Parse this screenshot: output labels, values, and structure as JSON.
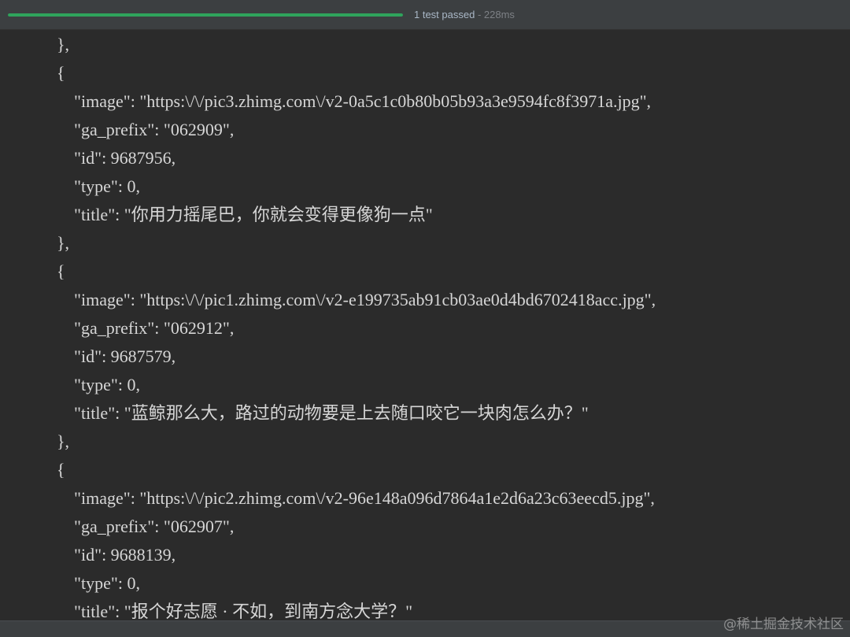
{
  "status": {
    "summary": "1 test passed",
    "duration": " - 228ms",
    "progress_percent": 100,
    "progress_color": "#2fa35c"
  },
  "output_lines": [
    {
      "indent": 0,
      "text": "},"
    },
    {
      "indent": 0,
      "text": "{"
    },
    {
      "indent": 1,
      "text": "\"image\": \"https:\\/\\/pic3.zhimg.com\\/v2-0a5c1c0b80b05b93a3e9594fc8f3971a.jpg\","
    },
    {
      "indent": 1,
      "text": "\"ga_prefix\": \"062909\","
    },
    {
      "indent": 1,
      "text": "\"id\": 9687956,"
    },
    {
      "indent": 1,
      "text": "\"type\": 0,"
    },
    {
      "indent": 1,
      "text": "\"title\": \"你用力摇尾巴，你就会变得更像狗一点\""
    },
    {
      "indent": 0,
      "text": "},"
    },
    {
      "indent": 0,
      "text": "{"
    },
    {
      "indent": 1,
      "text": "\"image\": \"https:\\/\\/pic1.zhimg.com\\/v2-e199735ab91cb03ae0d4bd6702418acc.jpg\","
    },
    {
      "indent": 1,
      "text": "\"ga_prefix\": \"062912\","
    },
    {
      "indent": 1,
      "text": "\"id\": 9687579,"
    },
    {
      "indent": 1,
      "text": "\"type\": 0,"
    },
    {
      "indent": 1,
      "text": "\"title\": \"蓝鲸那么大，路过的动物要是上去随口咬它一块肉怎么办？\""
    },
    {
      "indent": 0,
      "text": "},"
    },
    {
      "indent": 0,
      "text": "{"
    },
    {
      "indent": 1,
      "text": "\"image\": \"https:\\/\\/pic2.zhimg.com\\/v2-96e148a096d7864a1e2d6a23c63eecd5.jpg\","
    },
    {
      "indent": 1,
      "text": "\"ga_prefix\": \"062907\","
    },
    {
      "indent": 1,
      "text": "\"id\": 9688139,"
    },
    {
      "indent": 1,
      "text": "\"type\": 0,"
    },
    {
      "indent": 1,
      "text": "\"title\": \"报个好志愿 · 不如，到南方念大学？\""
    }
  ],
  "watermark": "@稀土掘金技术社区"
}
